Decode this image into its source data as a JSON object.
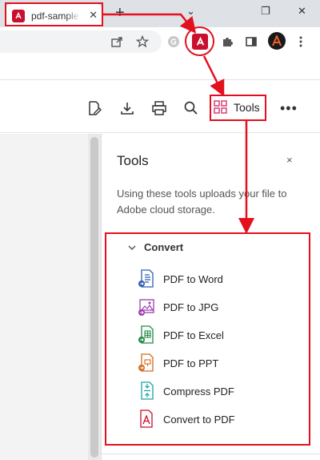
{
  "browser": {
    "tab_title": "pdf-sample",
    "tab_close": "✕",
    "new_tab": "+",
    "window_controls": {
      "minimize": "⌄",
      "restore": "❐",
      "close": "✕"
    }
  },
  "acrobat": {
    "tools_button_label": "Tools",
    "more_label": "•••"
  },
  "panel": {
    "title": "Tools",
    "close": "×",
    "description": "Using these tools uploads your file to Adobe cloud storage.",
    "section_label": "Convert",
    "items": [
      {
        "label": "PDF to Word",
        "icon": "pdf-to-word-icon",
        "color": "#2b5db5"
      },
      {
        "label": "PDF to JPG",
        "icon": "pdf-to-jpg-icon",
        "color": "#9b3fae"
      },
      {
        "label": "PDF to Excel",
        "icon": "pdf-to-excel-icon",
        "color": "#1e8a45"
      },
      {
        "label": "PDF to PPT",
        "icon": "pdf-to-ppt-icon",
        "color": "#d46a1a"
      },
      {
        "label": "Compress PDF",
        "icon": "compress-pdf-icon",
        "color": "#1aa3a3"
      },
      {
        "label": "Convert to PDF",
        "icon": "convert-to-pdf-icon",
        "color": "#c8102e"
      }
    ]
  },
  "colors": {
    "annotation": "#e3101e",
    "acrobat_red": "#c8102e",
    "tools_icon": "#d6336c"
  }
}
